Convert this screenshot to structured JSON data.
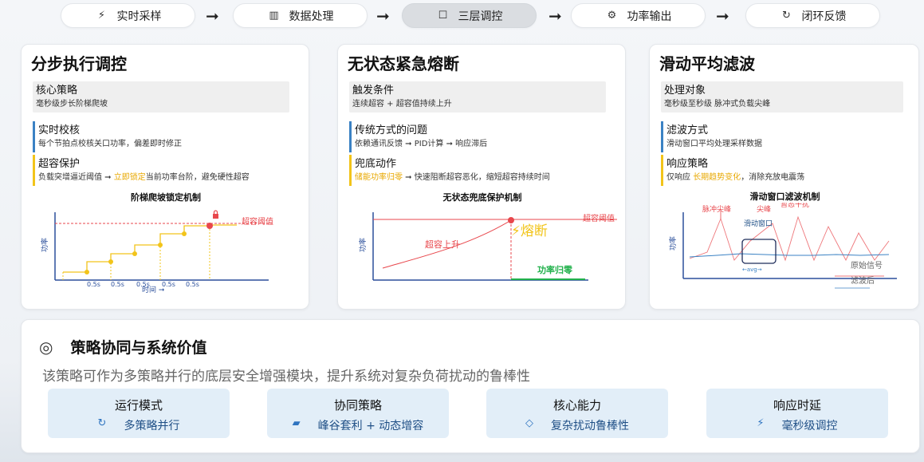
{
  "pipeline": {
    "steps": [
      {
        "label": "实时采样",
        "icon": "⚡"
      },
      {
        "label": "数据处理",
        "icon": "▥"
      },
      {
        "label": "三层调控",
        "icon": "☐"
      },
      {
        "label": "功率输出",
        "icon": "⚙"
      },
      {
        "label": "闭环反馈",
        "icon": "↻"
      }
    ],
    "arrow": "➞"
  },
  "cards": {
    "stepwise": {
      "title": "分步执行调控",
      "s1": {
        "title": "核心策略",
        "desc": "毫秒级步长阶梯爬坡"
      },
      "s2": {
        "title": "实时校核",
        "desc": "每个节拍点校核关口功率，偏差即时修正"
      },
      "s3": {
        "title": "超容保护",
        "desc_a": "负载突增逼近阈值 ➞ ",
        "desc_b": "立即锁定",
        "desc_c": "当前功率台阶，避免硬性超容"
      },
      "chart": {
        "title": "阶梯爬坡锁定机制",
        "ylabel": "功率",
        "xlabel": "时间 ➞",
        "threshold_label": "超容阈值",
        "tick_label": "0.5s"
      }
    },
    "fuse": {
      "title": "无状态紧急熔断",
      "s1": {
        "title": "触发条件",
        "desc": "连续超容 + 超容值持续上升"
      },
      "s2": {
        "title": "传统方式的问题",
        "desc": "依赖通讯反馈 ➞ PID计算 ➞ 响应滞后"
      },
      "s3": {
        "title": "兜底动作",
        "desc_a": "储能功率归零",
        "desc_b": " ➞ 快速阻断超容恶化，缩短超容持续时间"
      },
      "chart": {
        "title": "无状态兜底保护机制",
        "ylabel": "功率",
        "threshold_label": "超容阈值",
        "rise_label": "超容上升",
        "fuse_label": "⚡熔断",
        "zero_label": "功率归零"
      }
    },
    "filter": {
      "title": "滑动平均滤波",
      "s1": {
        "title": "处理对象",
        "desc": "毫秒级至秒级 脉冲式负载尖峰"
      },
      "s2": {
        "title": "滤波方式",
        "desc": "滑动窗口平均处理采样数据"
      },
      "s3": {
        "title": "响应策略",
        "desc_a": "仅响应 ",
        "desc_b": "长期趋势变化",
        "desc_c": "，消除充放电震荡"
      },
      "chart": {
        "title": "滑动窗口滤波机制",
        "ylabel": "功率",
        "pulse_label": "脉冲尖峰",
        "spike_label": "尖峰",
        "transient_label": "暂态干扰",
        "window_label": "滑动窗口",
        "avg_label": "←avg→",
        "raw_label": "原始信号",
        "filtered_label": "滤波后"
      }
    }
  },
  "colors": {
    "threshold": "#e8474c",
    "gold": "#f2c41a",
    "blue": "#2f74c0",
    "green": "#22b14c"
  },
  "bottom": {
    "title": "策略协同与系统价值",
    "icon": "◎",
    "subtitle": "该策略可作为多策略并行的底层安全增强模块，提升系统对复杂负荷扰动的鲁棒性",
    "pills": [
      {
        "title": "运行模式",
        "icon": "↻",
        "value": "多策略并行"
      },
      {
        "title": "协同策略",
        "icon": "▰",
        "value": "峰谷套利 + 动态增容"
      },
      {
        "title": "核心能力",
        "icon": "◇",
        "value": "复杂扰动鲁棒性"
      },
      {
        "title": "响应时延",
        "icon": "⚡",
        "value": "毫秒级调控"
      }
    ]
  }
}
